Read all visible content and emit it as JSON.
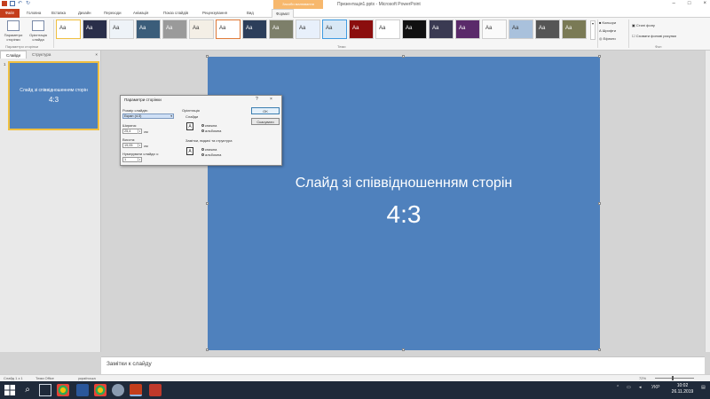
{
  "window": {
    "title": "Презентація1.pptx - Microsoft PowerPoint",
    "context_group": "Засоби малювання",
    "controls": [
      "–",
      "□",
      "×"
    ]
  },
  "tabs": [
    "Файл",
    "Головна",
    "Вставка",
    "Дизайн",
    "Переходи",
    "Анімація",
    "Показ слайдів",
    "Рецензування",
    "Вид",
    "Формат"
  ],
  "ribbon": {
    "page_setup": "Параметри сторінки",
    "orientation": "Орієнтація слайда",
    "group_page_setup": "Параметри сторінки",
    "group_themes": "Теми",
    "group_background": "Фон",
    "colors": "Кольори",
    "fonts": "Шрифти",
    "effects": "Ефекти",
    "bg_styles": "Стилі фону",
    "hide_bg": "Сховати фонові рисунки",
    "theme_label": "Aa"
  },
  "left_pane": {
    "tab_slides": "Слайди",
    "tab_outline": "Структура",
    "close": "×",
    "slide_number": "1",
    "thumb_title": "Слайд зі співвідношенням сторін",
    "thumb_sub": "4:3"
  },
  "slide": {
    "title": "Слайд зі співвідношенням сторін",
    "subtitle": "4:3"
  },
  "notes": {
    "placeholder": "Замітки к слайду"
  },
  "status": {
    "slide": "Слайд 1 з 1",
    "theme": "Тема Office",
    "lang": "українська",
    "zoom": "72%"
  },
  "dialog": {
    "title": "Параметри сторінки",
    "help": "?",
    "close": "×",
    "size_label": "Розмір слайдів:",
    "size_value": "Екран (4:3)",
    "width_label": "Ширина:",
    "width_value": "25,4",
    "height_label": "Висота:",
    "height_value": "19,05",
    "unit": "см",
    "number_label": "Нумерувати слайди з:",
    "number_value": "1",
    "orientation_label": "Орієнтація",
    "slides_label": "Слайди",
    "portrait": "книжна",
    "landscape": "альбомна",
    "notes_label": "Замітки, видачі та структура",
    "notes_portrait": "книжна",
    "notes_landscape": "альбомна",
    "ok": "OK",
    "cancel": "Скасувати"
  },
  "taskbar": {
    "clock_time": "10:02",
    "clock_date": "26.11.2019",
    "lang": "УКР"
  },
  "colors": {
    "accent": "#c43e1c",
    "slide_bg": "#4f81bd",
    "taskbar": "#1f2a3a"
  }
}
